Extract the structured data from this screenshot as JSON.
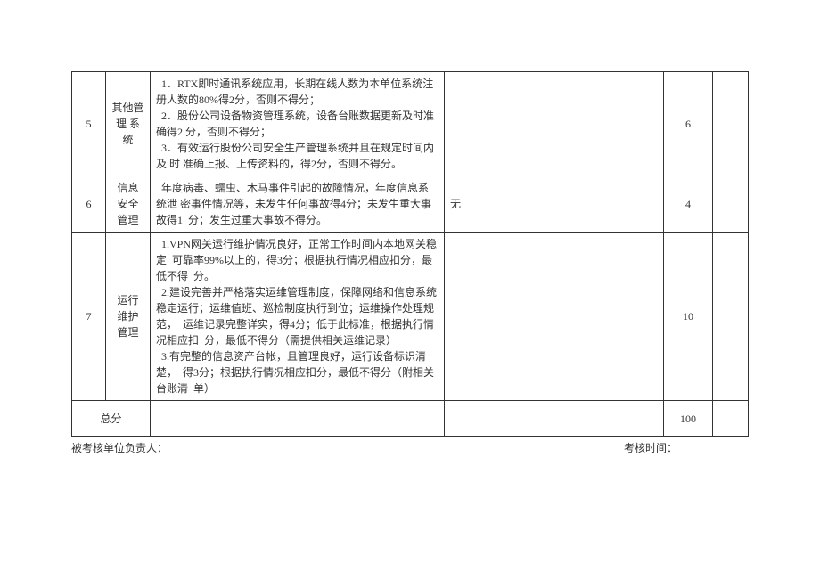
{
  "rows": [
    {
      "index": "5",
      "category": "其他管理 系统",
      "description": "  1．RTX即时通讯系统应用，长期在线人数为本单位系统注册人数的80%得2分，否则不得分；\n  2．股份公司设备物资管理系统，设备台账数据更新及时准确得2 分，否则不得分；\n  3．有效运行股份公司安全生产管理系统并且在规定时间内及 时 准确上报、上传资料的，得2分，否则不得分。",
      "col4": "",
      "score": "6",
      "last": ""
    },
    {
      "index": "6",
      "category": "信息 安全 管理",
      "description": "  年度病毒、蠕虫、木马事件引起的故障情况，年度信息系统泄 密事件情况等，未发生任何事故得4分；未发生重大事故得1  分；发生过重大事故不得分。",
      "col4": "无",
      "score": "4",
      "last": ""
    },
    {
      "index": "7",
      "category": "运行 维护 管理",
      "description": "  1.VPN网关运行维护情况良好，正常工作时间内本地网关稳定  可靠率99%以上的，得3分；根据执行情况相应扣分，最低不得  分。\n  2.建设完善并严格落实运维管理制度，保障网络和信息系统  稳定运行；运维值班、巡检制度执行到位；运维操作处理规范，  运维记录完整详实，得4分；低于此标准，根据执行情况相应扣  分，最低不得分（需提供相关运维记录）\n  3.有完整的信息资产台帐，且管理良好，运行设备标识清楚，  得3分；根据执行情况相应扣分，最低不得分（附相关台账清  单）",
      "col4": "",
      "score": "10",
      "last": ""
    }
  ],
  "total": {
    "label": "总分",
    "score": "100"
  },
  "footer": {
    "left": "被考核单位负责人：",
    "right": "考核时间："
  }
}
